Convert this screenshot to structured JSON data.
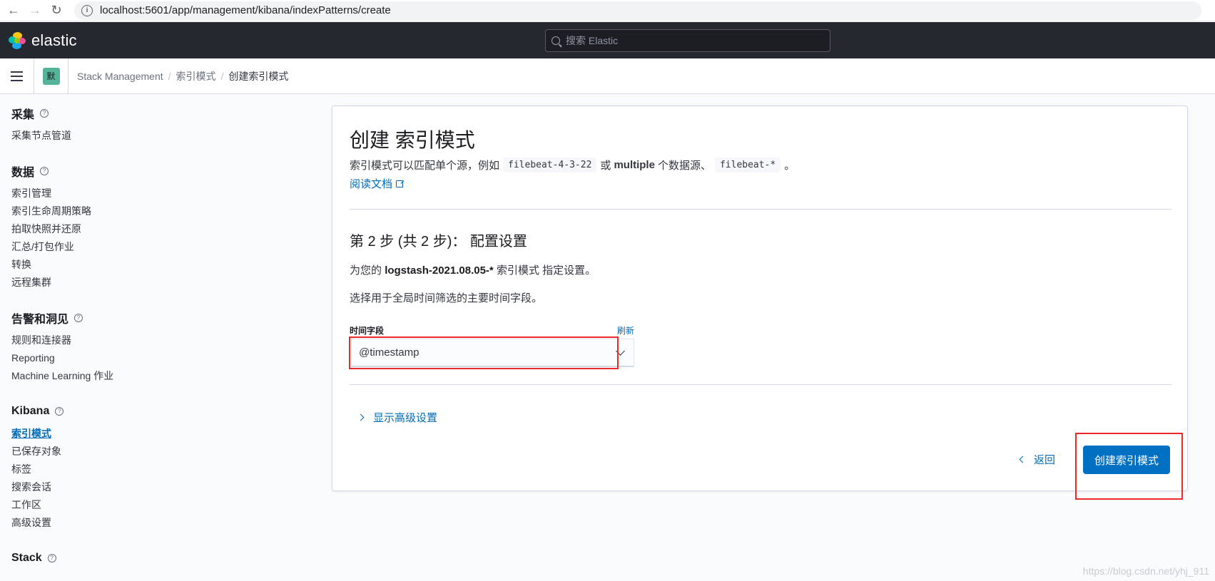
{
  "browser": {
    "url": "localhost:5601/app/management/kibana/indexPatterns/create"
  },
  "header": {
    "logo_text": "elastic",
    "search_placeholder": "搜索 Elastic"
  },
  "breadcrumb": {
    "space_avatar": "默",
    "items": [
      "Stack Management",
      "索引模式",
      "创建索引模式"
    ]
  },
  "sidebar": {
    "sections": [
      {
        "title": "采集",
        "items": [
          "采集节点管道"
        ]
      },
      {
        "title": "数据",
        "items": [
          "索引管理",
          "索引生命周期策略",
          "拍取快照并还原",
          "汇总/打包作业",
          "转换",
          "远程集群"
        ]
      },
      {
        "title": "告警和洞见",
        "items": [
          "规则和连接器",
          "Reporting",
          "Machine Learning 作业"
        ]
      },
      {
        "title": "Kibana",
        "items": [
          "索引模式",
          "已保存对象",
          "标签",
          "搜索会话",
          "工作区",
          "高级设置"
        ],
        "active_item": "索引模式"
      },
      {
        "title": "Stack",
        "items": []
      }
    ]
  },
  "main": {
    "title": "创建 索引模式",
    "description_prefix": "索引模式可以匹配单个源，例如",
    "code_example_1": "filebeat-4-3-22",
    "description_or": "或",
    "description_multiple": "multiple",
    "description_middle": "个数据源、",
    "code_example_2": "filebeat-*",
    "description_end": "。",
    "doc_link": "阅读文档",
    "step_title": "第 2 步 (共 2 步)： 配置设置",
    "step_desc_prefix": "为您的",
    "index_pattern_name": "logstash-2021.08.05-*",
    "step_desc_suffix": "索引模式 指定设置。",
    "step_hint": "选择用于全局时间筛选的主要时间字段。",
    "time_field_label": "时间字段",
    "refresh_label": "刷新",
    "time_field_value": "@timestamp",
    "advanced_toggle": "显示高级设置",
    "back_label": "返回",
    "create_label": "创建索引模式"
  },
  "watermark": "https://blog.csdn.net/yhj_911",
  "colors": {
    "header_bg": "#25282f",
    "primary": "#0071c2",
    "link": "#006bb8",
    "highlight": "#ef2929"
  }
}
